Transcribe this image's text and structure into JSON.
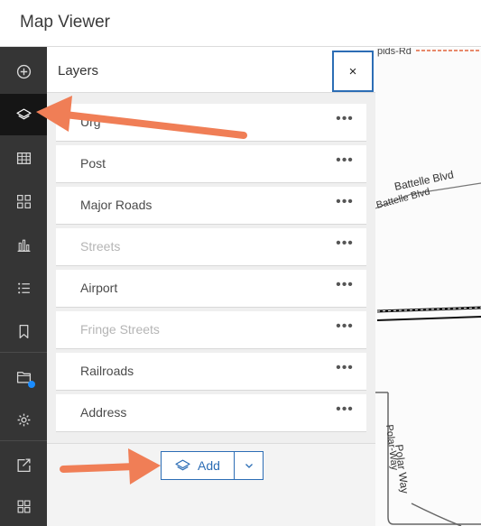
{
  "app": {
    "title": "Map Viewer"
  },
  "toolbar": {
    "items": [
      {
        "name": "add-icon"
      },
      {
        "name": "layers-icon"
      },
      {
        "name": "table-icon"
      },
      {
        "name": "legend-icon"
      },
      {
        "name": "charts-icon"
      },
      {
        "name": "list-icon"
      },
      {
        "name": "bookmark-icon"
      },
      {
        "name": "folder-icon"
      },
      {
        "name": "gear-icon"
      },
      {
        "name": "share-icon"
      },
      {
        "name": "apps-icon"
      }
    ]
  },
  "panel": {
    "title": "Layers",
    "close_label": "×",
    "layers": [
      {
        "label": "Urg",
        "visible": true
      },
      {
        "label": "Post",
        "visible": true
      },
      {
        "label": "Major Roads",
        "visible": true
      },
      {
        "label": "Streets",
        "visible": false
      },
      {
        "label": "Airport",
        "visible": true
      },
      {
        "label": "Fringe Streets",
        "visible": false
      },
      {
        "label": "Railroads",
        "visible": true
      },
      {
        "label": "Address",
        "visible": true
      }
    ],
    "more_label": "•••",
    "add_label": "Add"
  },
  "map": {
    "labels": {
      "top_road": "pids-Rd",
      "battelle_1": "Battelle Blvd",
      "battelle_2": "Battelle Blvd",
      "polar_1": "Polar Way",
      "polar_2": "Polar-Way"
    }
  },
  "colors": {
    "toolbar_bg": "#353535",
    "toolbar_active": "#151515",
    "accent": "#2c6db5",
    "arrow": "#f07e56",
    "notification": "#1a8cff"
  }
}
